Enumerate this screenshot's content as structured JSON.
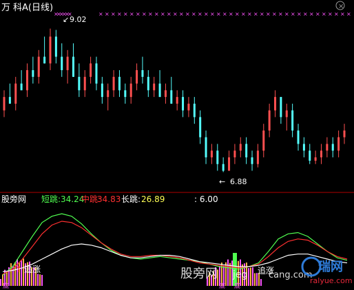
{
  "header": {
    "stock_char": "万",
    "title": "科A(日线)"
  },
  "colors": {
    "background": "#000000",
    "up": "#ff5050",
    "down": "#54ffff",
    "x_marker": "#ff55ff",
    "short_line": "#50ff50",
    "mid_line": "#ff3030",
    "long_line": "#ffffff",
    "separator": "#b00000",
    "white_text": "#ffffff",
    "yellow_text": "#ffff55",
    "watermark_blue": "#2e7bd8",
    "watermark_red": "#e8283a"
  },
  "price_panel": {
    "high_label": "9.02",
    "low_label": "6.88"
  },
  "indicator_panel": {
    "name": "股旁网",
    "short_label": "短跳:",
    "short_value": "34.24",
    "mid_label": "中跳:",
    "mid_value": "34.83",
    "long_label": "长跳:",
    "long_value": "26.89",
    "extra_value": ": 6.00",
    "signal_left": "追涨",
    "signal_right": "追涨",
    "bottom_chars": [
      "底",
      "底",
      "底"
    ]
  },
  "watermark": {
    "left_text": "股旁网",
    "middle_text": "jeg",
    "right_text": "cang.com",
    "logo_text": "瑞网",
    "url_text": "ralyue.com"
  },
  "chart_data": [
    {
      "type": "candlestick",
      "title": "科A(日线)",
      "annotations": [
        "9.02",
        "6.88"
      ],
      "ylim": [
        6.7,
        9.2
      ],
      "bars": [
        [
          7.8,
          8.1,
          7.7,
          8.0
        ],
        [
          8.0,
          8.2,
          7.9,
          7.9
        ],
        [
          7.9,
          8.3,
          7.8,
          8.2
        ],
        [
          8.2,
          8.4,
          8.1,
          8.1
        ],
        [
          8.1,
          8.5,
          8.0,
          8.4
        ],
        [
          8.4,
          8.6,
          8.2,
          8.3
        ],
        [
          8.3,
          8.7,
          8.2,
          8.6
        ],
        [
          8.6,
          8.9,
          8.5,
          8.5
        ],
        [
          8.5,
          9.02,
          8.4,
          8.9
        ],
        [
          8.9,
          9.0,
          8.5,
          8.6
        ],
        [
          8.6,
          8.8,
          8.3,
          8.4
        ],
        [
          8.4,
          8.7,
          8.2,
          8.6
        ],
        [
          8.6,
          8.8,
          8.3,
          8.3
        ],
        [
          8.3,
          8.5,
          8.0,
          8.1
        ],
        [
          8.1,
          8.4,
          8.0,
          8.3
        ],
        [
          8.3,
          8.6,
          8.2,
          8.5
        ],
        [
          8.5,
          8.6,
          8.1,
          8.2
        ],
        [
          8.2,
          8.3,
          7.9,
          8.0
        ],
        [
          8.0,
          8.2,
          7.8,
          8.1
        ],
        [
          8.1,
          8.4,
          8.0,
          8.3
        ],
        [
          8.3,
          8.4,
          8.0,
          8.1
        ],
        [
          8.1,
          8.2,
          7.9,
          8.0
        ],
        [
          8.0,
          8.3,
          7.9,
          8.2
        ],
        [
          8.2,
          8.5,
          8.1,
          8.4
        ],
        [
          8.4,
          8.6,
          8.2,
          8.3
        ],
        [
          8.3,
          8.4,
          8.0,
          8.1
        ],
        [
          8.1,
          8.3,
          8.0,
          8.2
        ],
        [
          8.2,
          8.4,
          8.0,
          8.0
        ],
        [
          8.0,
          8.2,
          7.9,
          8.1
        ],
        [
          8.1,
          8.3,
          7.9,
          7.9
        ],
        [
          7.9,
          8.1,
          7.8,
          8.0
        ],
        [
          8.0,
          8.1,
          7.7,
          7.8
        ],
        [
          7.8,
          8.0,
          7.7,
          7.9
        ],
        [
          7.9,
          8.0,
          7.6,
          7.7
        ],
        [
          7.7,
          7.8,
          7.3,
          7.4
        ],
        [
          7.4,
          7.5,
          7.0,
          7.1
        ],
        [
          7.1,
          7.3,
          7.0,
          7.2
        ],
        [
          7.2,
          7.3,
          6.9,
          7.0
        ],
        [
          7.0,
          7.1,
          6.88,
          6.9
        ],
        [
          6.9,
          7.2,
          6.9,
          7.1
        ],
        [
          7.1,
          7.3,
          7.0,
          7.2
        ],
        [
          7.2,
          7.4,
          7.1,
          7.3
        ],
        [
          7.3,
          7.4,
          7.0,
          7.1
        ],
        [
          7.1,
          7.2,
          6.9,
          7.0
        ],
        [
          7.0,
          7.3,
          6.95,
          7.2
        ],
        [
          7.2,
          7.6,
          7.1,
          7.5
        ],
        [
          7.5,
          7.9,
          7.4,
          7.8
        ],
        [
          7.8,
          8.1,
          7.7,
          8.0
        ],
        [
          8.0,
          8.0,
          7.6,
          7.7
        ],
        [
          7.7,
          7.9,
          7.5,
          7.8
        ],
        [
          7.8,
          7.9,
          7.4,
          7.5
        ],
        [
          7.5,
          7.6,
          7.2,
          7.3
        ],
        [
          7.3,
          7.4,
          7.1,
          7.2
        ],
        [
          7.2,
          7.3,
          7.0,
          7.05
        ],
        [
          7.05,
          7.2,
          7.0,
          7.1
        ],
        [
          7.1,
          7.3,
          7.0,
          7.2
        ],
        [
          7.2,
          7.4,
          7.1,
          7.3
        ],
        [
          7.3,
          7.4,
          7.1,
          7.2
        ],
        [
          7.2,
          7.5,
          7.1,
          7.4
        ],
        [
          7.4,
          7.6,
          7.3,
          7.5
        ]
      ]
    },
    {
      "type": "line",
      "series": [
        {
          "name": "短跳",
          "values": [
            5,
            12,
            24,
            36,
            47,
            52,
            54,
            52,
            46,
            38,
            31,
            25,
            21,
            19,
            18,
            19,
            20,
            19,
            18,
            17,
            16,
            14,
            12,
            11,
            10,
            12,
            15,
            24,
            34,
            38,
            39,
            36,
            30,
            24,
            19,
            17
          ]
        },
        {
          "name": "中跳",
          "values": [
            6,
            10,
            18,
            28,
            38,
            45,
            48,
            47,
            43,
            37,
            31,
            26,
            22,
            20,
            20,
            21,
            21,
            20,
            19,
            17,
            15,
            14,
            13,
            12,
            11,
            12,
            14,
            20,
            27,
            32,
            34,
            33,
            29,
            24,
            20,
            18
          ]
        },
        {
          "name": "长跳",
          "values": [
            8,
            9,
            11,
            14,
            18,
            22,
            26,
            29,
            30,
            29,
            27,
            24,
            21,
            19,
            19,
            20,
            21,
            21,
            20,
            18,
            16,
            15,
            14,
            13,
            12,
            12,
            13,
            15,
            18,
            21,
            22,
            22,
            20,
            18,
            16,
            15
          ]
        }
      ]
    }
  ]
}
